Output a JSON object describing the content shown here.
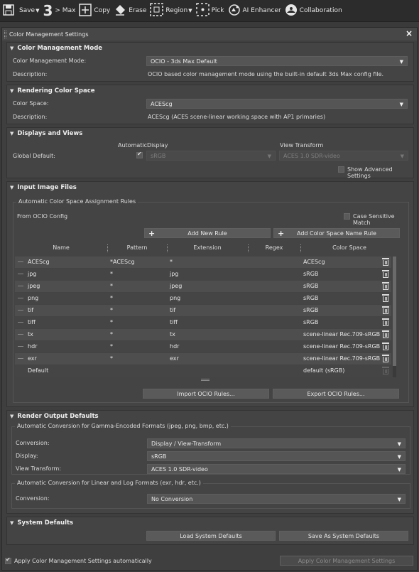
{
  "toolbar": {
    "save": "Save",
    "max_number": "3",
    "max": "> Max",
    "copy": "Copy",
    "erase": "Erase",
    "region": "Region",
    "pick": "Pick",
    "ai_enhancer": "AI Enhancer",
    "collaboration": "Collaboration"
  },
  "dialog": {
    "title": "Color Management Settings",
    "close": "×"
  },
  "cm_mode": {
    "header": "Color Management Mode",
    "mode_label": "Color Management Mode:",
    "mode_value": "OCIO - 3ds Max Default",
    "desc_label": "Description:",
    "desc_value": "OCIO based color management mode using the built-in default 3ds Max config file."
  },
  "rendering": {
    "header": "Rendering Color Space",
    "cs_label": "Color Space:",
    "cs_value": "ACEScg",
    "desc_label": "Description:",
    "desc_value": "ACEScg (ACES scene-linear working space with AP1 primaries)"
  },
  "displays": {
    "header": "Displays and Views",
    "col_automatic": "Automatic",
    "col_display": "Display",
    "col_view": "View Transform",
    "global_label": "Global Default:",
    "display_value": "sRGB",
    "view_value": "ACES 1.0 SDR-video",
    "show_advanced": "Show Advanced Settings",
    "automatic_checked": true
  },
  "input_files": {
    "header": "Input Image Files",
    "group_title": "Automatic Color Space Assignment Rules",
    "from_ocio": "From OCIO Config",
    "case_sensitive": "Case Sensitive Match",
    "add_new_rule": "Add New Rule",
    "add_cs_name_rule": "Add Color Space Name Rule",
    "columns": [
      "Name",
      "Pattern",
      "Extension",
      "Regex",
      "Color Space"
    ],
    "rows": [
      {
        "name": "ACEScg",
        "pattern": "*ACEScg",
        "extension": "*",
        "regex": "",
        "color_space": "ACEScg"
      },
      {
        "name": "jpg",
        "pattern": "*",
        "extension": "jpg",
        "regex": "",
        "color_space": "sRGB"
      },
      {
        "name": "jpeg",
        "pattern": "*",
        "extension": "jpeg",
        "regex": "",
        "color_space": "sRGB"
      },
      {
        "name": "png",
        "pattern": "*",
        "extension": "png",
        "regex": "",
        "color_space": "sRGB"
      },
      {
        "name": "tif",
        "pattern": "*",
        "extension": "tif",
        "regex": "",
        "color_space": "sRGB"
      },
      {
        "name": "tiff",
        "pattern": "*",
        "extension": "tiff",
        "regex": "",
        "color_space": "sRGB"
      },
      {
        "name": "tx",
        "pattern": "*",
        "extension": "tx",
        "regex": "",
        "color_space": "scene-linear Rec.709-sRGB"
      },
      {
        "name": "hdr",
        "pattern": "*",
        "extension": "hdr",
        "regex": "",
        "color_space": "scene-linear Rec.709-sRGB"
      },
      {
        "name": "exr",
        "pattern": "*",
        "extension": "exr",
        "regex": "",
        "color_space": "scene-linear Rec.709-sRGB"
      },
      {
        "name": "Default",
        "pattern": "",
        "extension": "",
        "regex": "",
        "color_space": "default (sRGB)"
      }
    ],
    "import_rules": "Import OCIO Rules...",
    "export_rules": "Export OCIO Rules..."
  },
  "render_output": {
    "header": "Render Output Defaults",
    "gamma_group": "Automatic Conversion for Gamma-Encoded Formats (jpeg, png, bmp, etc.)",
    "conversion_label": "Conversion:",
    "conversion_value": "Display / View-Transform",
    "display_label": "Display:",
    "display_value": "sRGB",
    "view_label": "View Transform:",
    "view_value": "ACES 1.0 SDR-video",
    "linear_group": "Automatic Conversion for Linear and Log Formats (exr, hdr, etc.)",
    "linear_conversion_label": "Conversion:",
    "linear_conversion_value": "No Conversion"
  },
  "system_defaults": {
    "header": "System Defaults",
    "load": "Load System Defaults",
    "save": "Save As System Defaults"
  },
  "footer": {
    "apply_auto": "Apply Color Management Settings automatically",
    "apply_button": "Apply Color Management Settings"
  }
}
